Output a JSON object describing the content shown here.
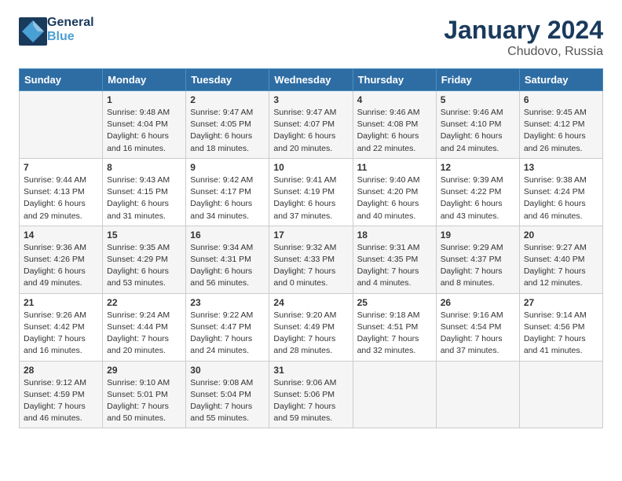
{
  "header": {
    "logo_line1": "General",
    "logo_line2": "Blue",
    "month_title": "January 2024",
    "location": "Chudovo, Russia"
  },
  "days_of_week": [
    "Sunday",
    "Monday",
    "Tuesday",
    "Wednesday",
    "Thursday",
    "Friday",
    "Saturday"
  ],
  "weeks": [
    [
      {
        "day": "",
        "sunrise": "",
        "sunset": "",
        "daylight": ""
      },
      {
        "day": "1",
        "sunrise": "Sunrise: 9:48 AM",
        "sunset": "Sunset: 4:04 PM",
        "daylight": "Daylight: 6 hours and 16 minutes."
      },
      {
        "day": "2",
        "sunrise": "Sunrise: 9:47 AM",
        "sunset": "Sunset: 4:05 PM",
        "daylight": "Daylight: 6 hours and 18 minutes."
      },
      {
        "day": "3",
        "sunrise": "Sunrise: 9:47 AM",
        "sunset": "Sunset: 4:07 PM",
        "daylight": "Daylight: 6 hours and 20 minutes."
      },
      {
        "day": "4",
        "sunrise": "Sunrise: 9:46 AM",
        "sunset": "Sunset: 4:08 PM",
        "daylight": "Daylight: 6 hours and 22 minutes."
      },
      {
        "day": "5",
        "sunrise": "Sunrise: 9:46 AM",
        "sunset": "Sunset: 4:10 PM",
        "daylight": "Daylight: 6 hours and 24 minutes."
      },
      {
        "day": "6",
        "sunrise": "Sunrise: 9:45 AM",
        "sunset": "Sunset: 4:12 PM",
        "daylight": "Daylight: 6 hours and 26 minutes."
      }
    ],
    [
      {
        "day": "7",
        "sunrise": "Sunrise: 9:44 AM",
        "sunset": "Sunset: 4:13 PM",
        "daylight": "Daylight: 6 hours and 29 minutes."
      },
      {
        "day": "8",
        "sunrise": "Sunrise: 9:43 AM",
        "sunset": "Sunset: 4:15 PM",
        "daylight": "Daylight: 6 hours and 31 minutes."
      },
      {
        "day": "9",
        "sunrise": "Sunrise: 9:42 AM",
        "sunset": "Sunset: 4:17 PM",
        "daylight": "Daylight: 6 hours and 34 minutes."
      },
      {
        "day": "10",
        "sunrise": "Sunrise: 9:41 AM",
        "sunset": "Sunset: 4:19 PM",
        "daylight": "Daylight: 6 hours and 37 minutes."
      },
      {
        "day": "11",
        "sunrise": "Sunrise: 9:40 AM",
        "sunset": "Sunset: 4:20 PM",
        "daylight": "Daylight: 6 hours and 40 minutes."
      },
      {
        "day": "12",
        "sunrise": "Sunrise: 9:39 AM",
        "sunset": "Sunset: 4:22 PM",
        "daylight": "Daylight: 6 hours and 43 minutes."
      },
      {
        "day": "13",
        "sunrise": "Sunrise: 9:38 AM",
        "sunset": "Sunset: 4:24 PM",
        "daylight": "Daylight: 6 hours and 46 minutes."
      }
    ],
    [
      {
        "day": "14",
        "sunrise": "Sunrise: 9:36 AM",
        "sunset": "Sunset: 4:26 PM",
        "daylight": "Daylight: 6 hours and 49 minutes."
      },
      {
        "day": "15",
        "sunrise": "Sunrise: 9:35 AM",
        "sunset": "Sunset: 4:29 PM",
        "daylight": "Daylight: 6 hours and 53 minutes."
      },
      {
        "day": "16",
        "sunrise": "Sunrise: 9:34 AM",
        "sunset": "Sunset: 4:31 PM",
        "daylight": "Daylight: 6 hours and 56 minutes."
      },
      {
        "day": "17",
        "sunrise": "Sunrise: 9:32 AM",
        "sunset": "Sunset: 4:33 PM",
        "daylight": "Daylight: 7 hours and 0 minutes."
      },
      {
        "day": "18",
        "sunrise": "Sunrise: 9:31 AM",
        "sunset": "Sunset: 4:35 PM",
        "daylight": "Daylight: 7 hours and 4 minutes."
      },
      {
        "day": "19",
        "sunrise": "Sunrise: 9:29 AM",
        "sunset": "Sunset: 4:37 PM",
        "daylight": "Daylight: 7 hours and 8 minutes."
      },
      {
        "day": "20",
        "sunrise": "Sunrise: 9:27 AM",
        "sunset": "Sunset: 4:40 PM",
        "daylight": "Daylight: 7 hours and 12 minutes."
      }
    ],
    [
      {
        "day": "21",
        "sunrise": "Sunrise: 9:26 AM",
        "sunset": "Sunset: 4:42 PM",
        "daylight": "Daylight: 7 hours and 16 minutes."
      },
      {
        "day": "22",
        "sunrise": "Sunrise: 9:24 AM",
        "sunset": "Sunset: 4:44 PM",
        "daylight": "Daylight: 7 hours and 20 minutes."
      },
      {
        "day": "23",
        "sunrise": "Sunrise: 9:22 AM",
        "sunset": "Sunset: 4:47 PM",
        "daylight": "Daylight: 7 hours and 24 minutes."
      },
      {
        "day": "24",
        "sunrise": "Sunrise: 9:20 AM",
        "sunset": "Sunset: 4:49 PM",
        "daylight": "Daylight: 7 hours and 28 minutes."
      },
      {
        "day": "25",
        "sunrise": "Sunrise: 9:18 AM",
        "sunset": "Sunset: 4:51 PM",
        "daylight": "Daylight: 7 hours and 32 minutes."
      },
      {
        "day": "26",
        "sunrise": "Sunrise: 9:16 AM",
        "sunset": "Sunset: 4:54 PM",
        "daylight": "Daylight: 7 hours and 37 minutes."
      },
      {
        "day": "27",
        "sunrise": "Sunrise: 9:14 AM",
        "sunset": "Sunset: 4:56 PM",
        "daylight": "Daylight: 7 hours and 41 minutes."
      }
    ],
    [
      {
        "day": "28",
        "sunrise": "Sunrise: 9:12 AM",
        "sunset": "Sunset: 4:59 PM",
        "daylight": "Daylight: 7 hours and 46 minutes."
      },
      {
        "day": "29",
        "sunrise": "Sunrise: 9:10 AM",
        "sunset": "Sunset: 5:01 PM",
        "daylight": "Daylight: 7 hours and 50 minutes."
      },
      {
        "day": "30",
        "sunrise": "Sunrise: 9:08 AM",
        "sunset": "Sunset: 5:04 PM",
        "daylight": "Daylight: 7 hours and 55 minutes."
      },
      {
        "day": "31",
        "sunrise": "Sunrise: 9:06 AM",
        "sunset": "Sunset: 5:06 PM",
        "daylight": "Daylight: 7 hours and 59 minutes."
      },
      {
        "day": "",
        "sunrise": "",
        "sunset": "",
        "daylight": ""
      },
      {
        "day": "",
        "sunrise": "",
        "sunset": "",
        "daylight": ""
      },
      {
        "day": "",
        "sunrise": "",
        "sunset": "",
        "daylight": ""
      }
    ]
  ]
}
